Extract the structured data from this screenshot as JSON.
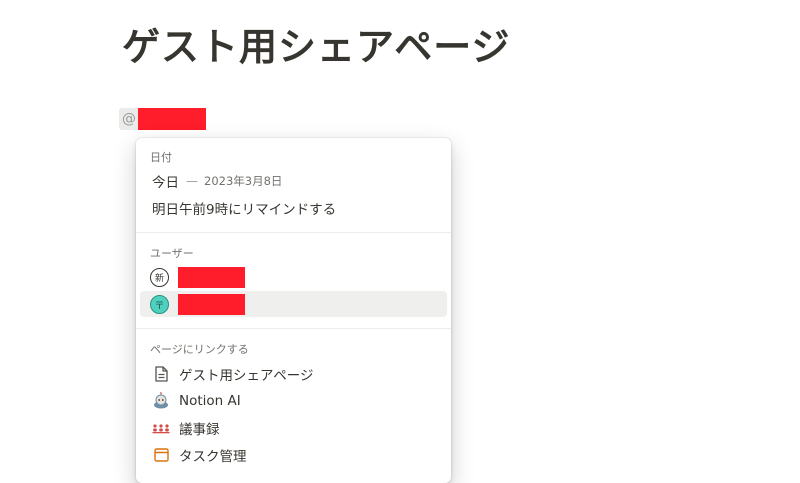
{
  "page": {
    "title": "ゲスト用シェアページ"
  },
  "mention": {
    "trigger": "@"
  },
  "menu": {
    "date_section": {
      "header": "日付",
      "today_label": "今日",
      "separator": "—",
      "today_date": "2023年3月8日",
      "reminder_label": "明日午前9時にリマインドする"
    },
    "user_section": {
      "header": "ユーザー",
      "users": [
        {
          "avatar_text": "新",
          "avatar_icon": "new-user-avatar"
        },
        {
          "avatar_text": "〒",
          "avatar_icon": "user-avatar",
          "selected": true
        }
      ]
    },
    "link_section": {
      "header": "ページにリンクする",
      "pages": [
        {
          "label": "ゲスト用シェアページ",
          "icon": "document-icon"
        },
        {
          "label": "Notion AI",
          "icon": "notion-ai-icon"
        },
        {
          "label": "議事録",
          "icon": "meeting-notes-icon"
        },
        {
          "label": "タスク管理",
          "icon": "task-board-icon"
        }
      ]
    }
  },
  "colors": {
    "redaction": "#ff1c2b",
    "text": "#37352f",
    "muted": "#73726e",
    "selected_bg": "#efefee",
    "avatar_teal": "#4fd1bf"
  }
}
